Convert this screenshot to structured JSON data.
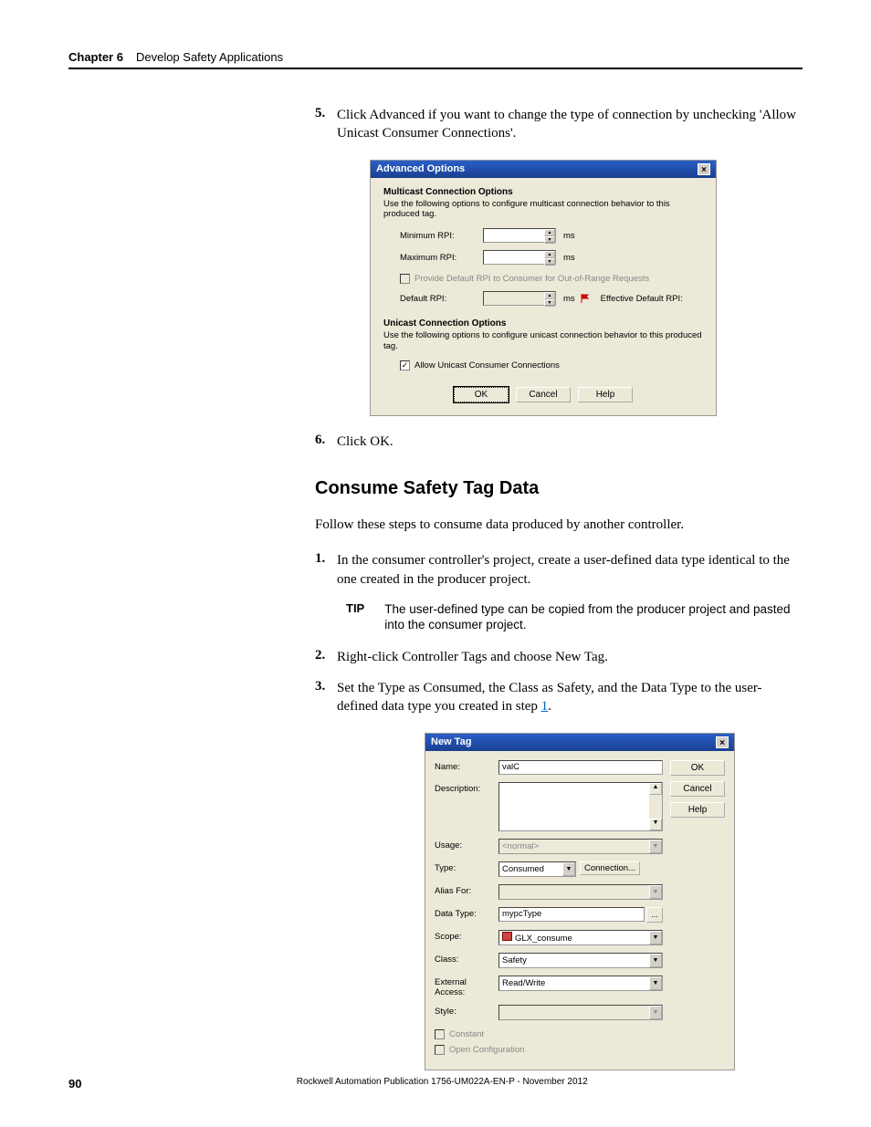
{
  "header": {
    "chapter_label": "Chapter 6",
    "chapter_title": "Develop Safety Applications"
  },
  "steps_a": [
    {
      "num": "5.",
      "text": "Click Advanced if you want to change the type of connection by unchecking 'Allow Unicast Consumer Connections'."
    },
    {
      "num": "6.",
      "text": "Click OK."
    }
  ],
  "dialog_adv": {
    "title": "Advanced Options",
    "multicast_header": "Multicast Connection Options",
    "multicast_desc": "Use the following options to configure multicast connection behavior to this produced tag.",
    "min_rpi_label": "Minimum RPI:",
    "max_rpi_label": "Maximum RPI:",
    "unit": "ms",
    "provide_default_label": "Provide Default RPI to Consumer for Out-of-Range Requests",
    "default_rpi_label": "Default RPI:",
    "effective_label": "Effective Default RPI:",
    "unicast_header": "Unicast Connection Options",
    "unicast_desc": "Use the following options to configure unicast connection behavior to this produced tag.",
    "allow_unicast_label": "Allow Unicast Consumer Connections",
    "ok": "OK",
    "cancel": "Cancel",
    "help": "Help"
  },
  "section": {
    "heading": "Consume Safety Tag Data",
    "intro": "Follow these steps to consume data produced by another controller."
  },
  "steps_b": [
    {
      "num": "1.",
      "text": "In the consumer controller's project, create a user-defined data type identical to the one created in the producer project."
    },
    {
      "num": "2.",
      "text": "Right-click Controller Tags and choose New Tag."
    },
    {
      "num": "3.",
      "text_pre": "Set the Type as Consumed, the Class as Safety, and the Data Type to the user-defined data type you created in step ",
      "link": "1",
      "text_post": "."
    }
  ],
  "tip": {
    "label": "TIP",
    "text": "The user-defined type can be copied from the producer project and pasted into the consumer project."
  },
  "dialog_newtag": {
    "title": "New Tag",
    "labels": {
      "name": "Name:",
      "description": "Description:",
      "usage": "Usage:",
      "type": "Type:",
      "alias": "Alias For:",
      "datatype": "Data Type:",
      "scope": "Scope:",
      "class": "Class:",
      "external": "External Access:",
      "style": "Style:"
    },
    "values": {
      "name": "valC",
      "usage": "<normal>",
      "type": "Consumed",
      "connection_btn": "Connection...",
      "datatype": "mypcType",
      "scope": "GLX_consume",
      "class": "Safety",
      "external": "Read/Write",
      "style": ""
    },
    "constant": "Constant",
    "open_config": "Open Configuration",
    "ok": "OK",
    "cancel": "Cancel",
    "help": "Help"
  },
  "footer": {
    "page": "90",
    "pub": "Rockwell Automation Publication 1756-UM022A-EN-P - November 2012"
  }
}
